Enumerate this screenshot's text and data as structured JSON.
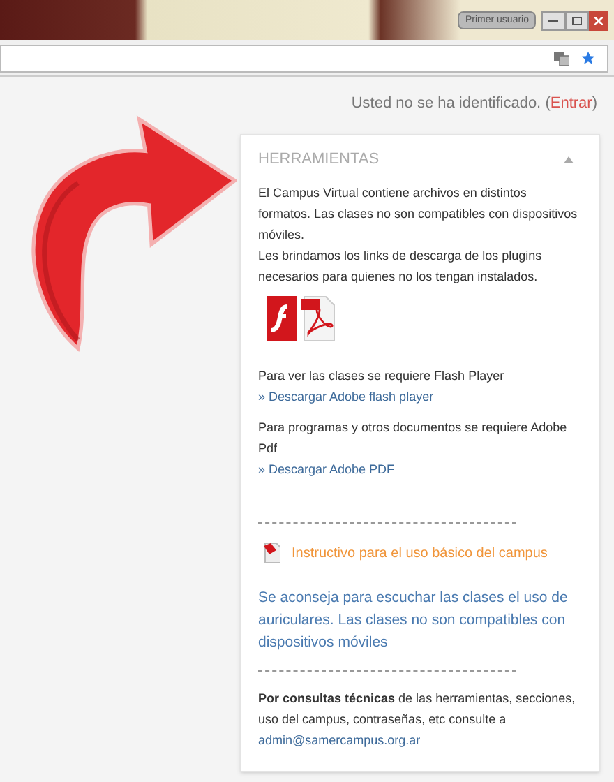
{
  "window": {
    "user_button": "Primer usuario"
  },
  "login": {
    "message": "Usted no se ha identificado.",
    "open": "(",
    "link": "Entrar",
    "close": ")"
  },
  "block": {
    "title": "HERRAMIENTAS",
    "expanded": true,
    "intro": "El Campus Virtual contiene archivos en distintos formatos. Las clases no son compatibles con dispositivos móviles.",
    "intro2": "Les brindamos los links de descarga de los plugins necesarios para quienes no los tengan instalados.",
    "downloads": [
      {
        "text": "Para ver las clases se requiere Flash Player",
        "link": "» Descargar Adobe flash player"
      },
      {
        "text": "Para programas y otros documentos se requiere Adobe Pdf",
        "link": "» Descargar Adobe PDF"
      }
    ],
    "guide_link": "Instructivo para el uso básico del campus",
    "advice": "Se aconseja para escuchar las clases el uso de auriculares. Las clases no son compatibles con dispositivos móviles",
    "contact": "**Por consultas técnicas** de las herramientas, secciones, uso del campus, contraseñas, etc consulte a",
    "email": "admin@samercampus.org.ar"
  }
}
